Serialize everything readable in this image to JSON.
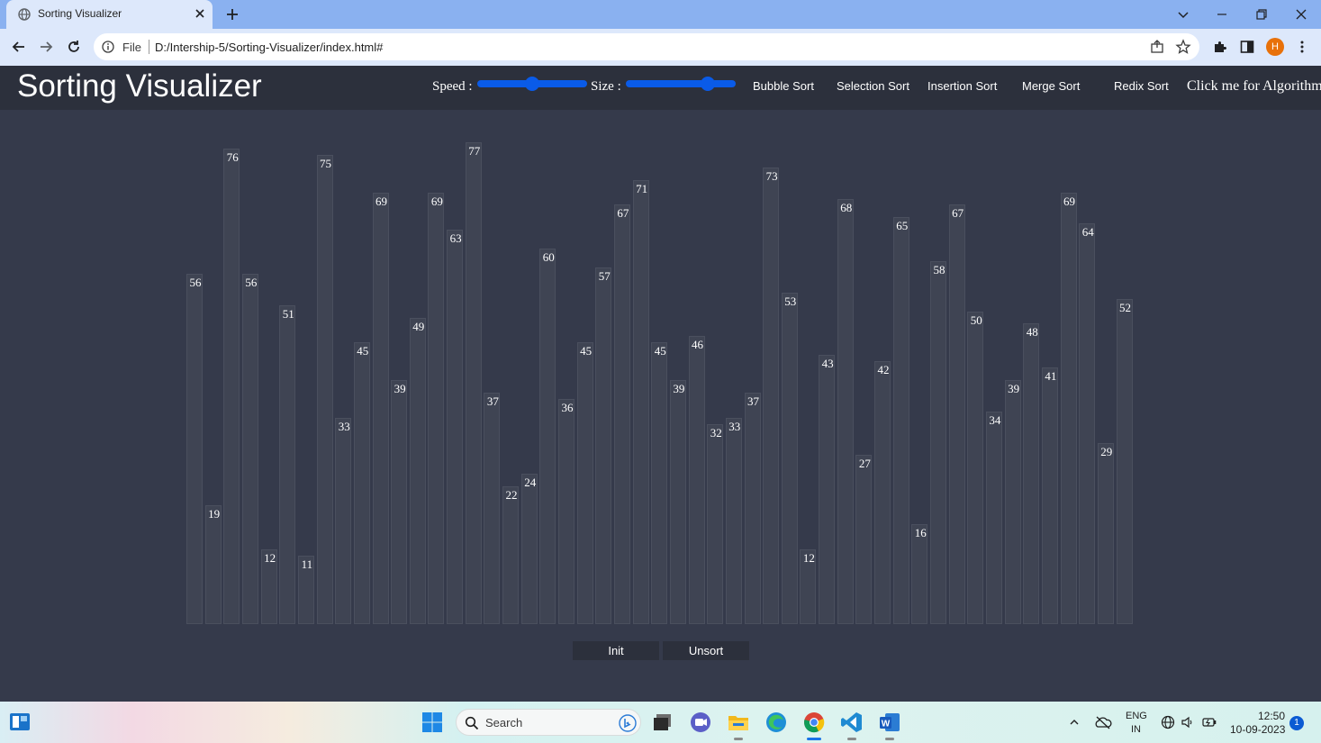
{
  "browser": {
    "tab_title": "Sorting Visualizer",
    "address_scheme": "File",
    "address_url": "D:/Intership-5/Sorting-Visualizer/index.html#",
    "profile_initial": "H"
  },
  "app": {
    "title": "Sorting Visualizer",
    "speed_label": "Speed :",
    "size_label": "Size :",
    "speed_value": 0.5,
    "size_value": 0.78,
    "algorithms": [
      "Bubble Sort",
      "Selection Sort",
      "Insertion Sort",
      "Merge Sort",
      "Redix Sort"
    ],
    "algo_link": "Click me for Algorithm!",
    "init_label": "Init",
    "unsort_label": "Unsort",
    "bars": [
      56,
      19,
      76,
      56,
      12,
      51,
      11,
      75,
      33,
      45,
      69,
      39,
      49,
      69,
      63,
      77,
      37,
      22,
      24,
      60,
      36,
      45,
      57,
      67,
      71,
      45,
      39,
      46,
      32,
      33,
      37,
      73,
      53,
      12,
      43,
      68,
      27,
      42,
      65,
      16,
      58,
      67,
      50,
      34,
      39,
      48,
      41,
      69,
      64,
      29,
      52
    ]
  },
  "taskbar": {
    "search_label": "Search",
    "lang_line1": "ENG",
    "lang_line2": "IN",
    "time": "12:50",
    "date": "10-09-2023",
    "notification_count": "1"
  },
  "colors": {
    "page_bg": "#353a4b",
    "navbar_bg": "#2c303c",
    "bar_fill": "#3f4453",
    "slider_blue": "#0a5be8",
    "tabstrip": "#8ab1f0"
  },
  "icons": {
    "favicon": "globe-icon",
    "close": "close-icon",
    "new_tab": "plus-icon",
    "back": "back-arrow-icon",
    "forward": "forward-arrow-icon",
    "reload": "reload-icon",
    "info": "info-icon",
    "share": "share-icon",
    "bookmark": "star-icon",
    "extensions": "puzzle-icon",
    "sidepanel": "side-panel-icon",
    "menu": "kebab-menu-icon"
  }
}
